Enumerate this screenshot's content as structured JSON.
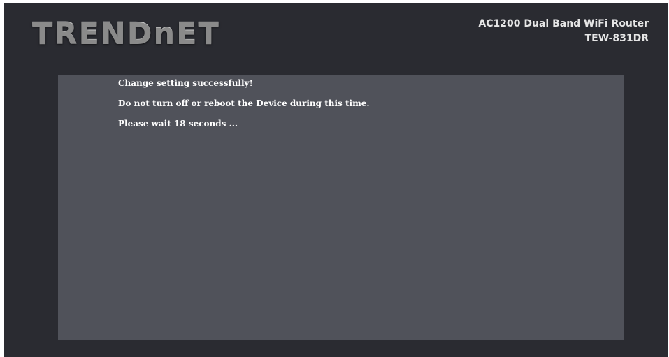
{
  "header": {
    "logo_text": "TRENDnET",
    "product_name": "AC1200 Dual Band WiFi Router",
    "model": "TEW-831DR"
  },
  "status": {
    "messages": [
      "Change setting successfully!",
      "Do not turn off or reboot the Device during this time.",
      "Please wait 18 seconds ..."
    ]
  }
}
